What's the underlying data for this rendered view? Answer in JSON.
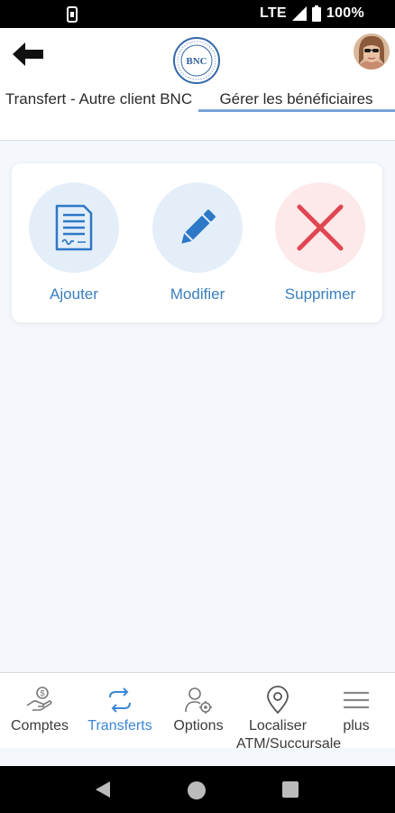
{
  "status_bar": {
    "network": "LTE",
    "battery": "100%"
  },
  "header": {
    "logo_text": "BNC",
    "tabs": [
      {
        "label": "Transfert - Autre client BNC"
      },
      {
        "label": "Gérer les bénéficiaires"
      }
    ]
  },
  "actions": [
    {
      "label": "Ajouter",
      "icon": "document-icon"
    },
    {
      "label": "Modifier",
      "icon": "pencil-icon"
    },
    {
      "label": "Supprimer",
      "icon": "close-x-icon"
    }
  ],
  "bottom_nav": {
    "items": [
      {
        "label": "Comptes",
        "icon": "money-hand-icon"
      },
      {
        "label": "Transferts",
        "icon": "transfer-arrows-icon"
      },
      {
        "label": "Options",
        "icon": "user-settings-icon"
      },
      {
        "label": "Localiser ATM/Succursale",
        "icon": "location-pin-icon"
      },
      {
        "label": "plus",
        "icon": "menu-icon"
      }
    ],
    "active_index": 1
  },
  "colors": {
    "accent_blue": "#3a7fbf",
    "active_tab_underline": "#7aa2d9",
    "delete_red": "#e0474f"
  }
}
